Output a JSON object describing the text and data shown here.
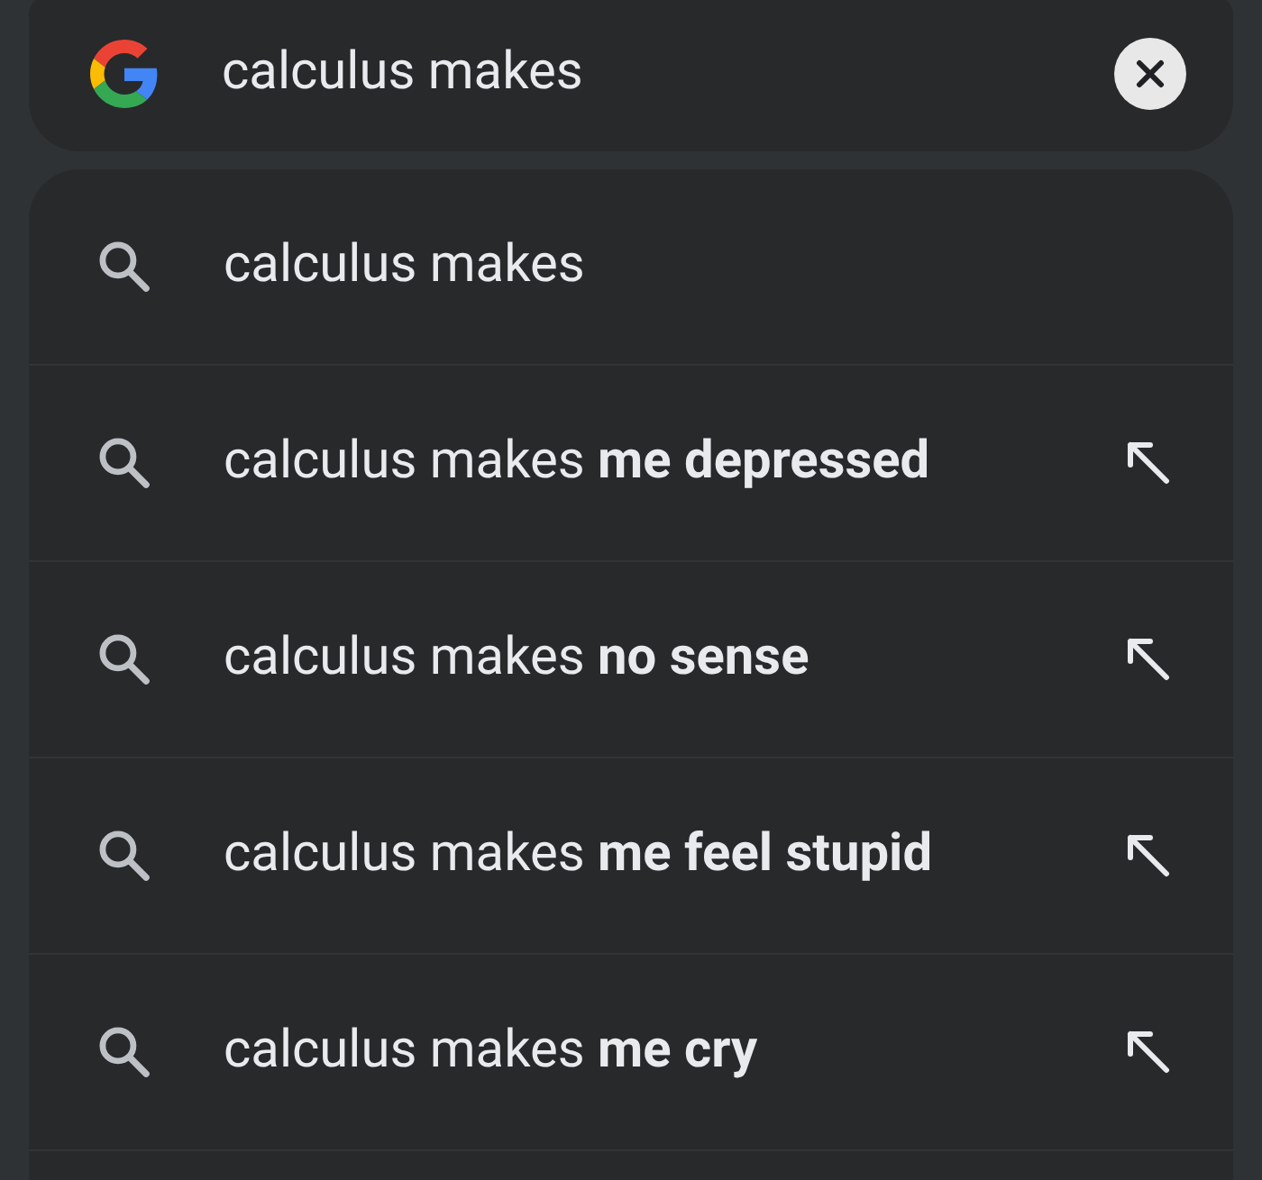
{
  "search_bar": {
    "value": "calculus makes",
    "clear_button": true
  },
  "suggestions": [
    {
      "text": "calculus makes",
      "fill_arrow": false
    },
    {
      "text": "calculus makes **me depressed**",
      "fill_arrow": true
    },
    {
      "text": "calculus makes **no sense**",
      "fill_arrow": true
    },
    {
      "text": "calculus makes **me feel stupid**",
      "fill_arrow": true
    },
    {
      "text": "calculus makes **me cry**",
      "fill_arrow": true
    }
  ]
}
